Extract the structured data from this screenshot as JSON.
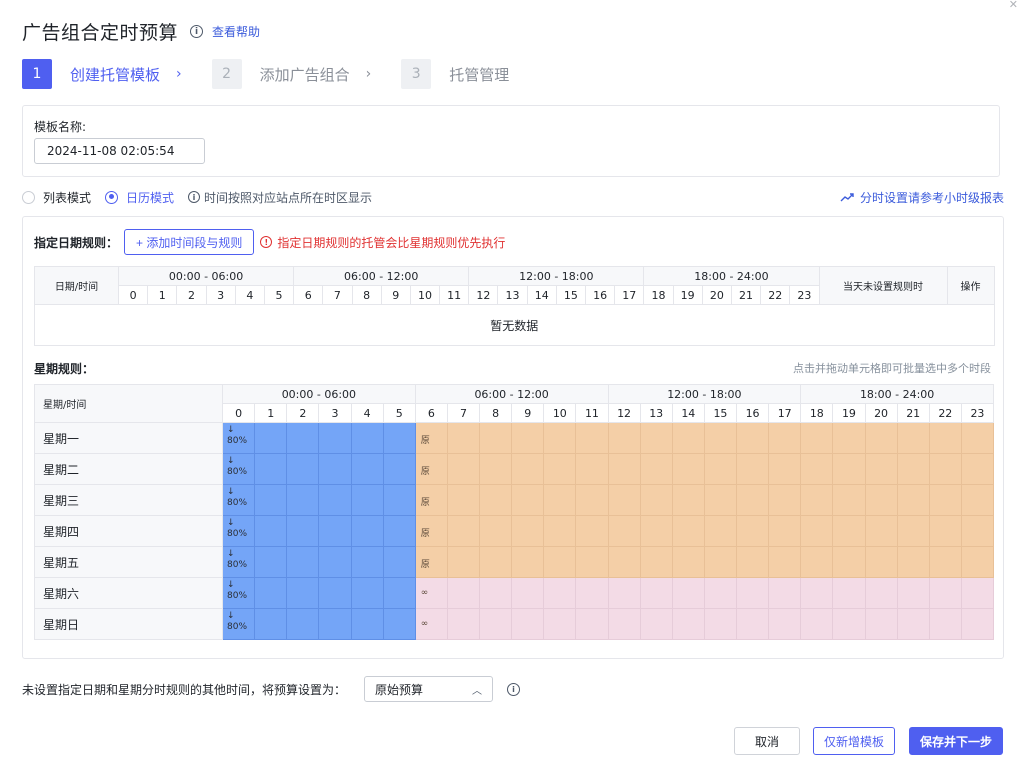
{
  "header": {
    "title": "广告组合定时预算",
    "help_link": "查看帮助"
  },
  "steps": [
    {
      "num": "1",
      "label": "创建托管模板",
      "arrow": "›"
    },
    {
      "num": "2",
      "label": "添加广告组合",
      "arrow": "›"
    },
    {
      "num": "3",
      "label": "托管管理"
    }
  ],
  "template": {
    "name_label": "模板名称:",
    "name_value": "2024-11-08 02:05:54"
  },
  "mode": {
    "list_label": "列表模式",
    "calendar_label": "日历模式",
    "selected": "calendar",
    "note": "时间按照对应站点所在时区显示",
    "report_link": "分时设置请参考小时级报表"
  },
  "date_rules": {
    "label": "指定日期规则：",
    "add_button": "+ 添加时间段与规则",
    "warning": "指定日期规则的托管会比星期规则优先执行",
    "col_date_time": "日期/时间",
    "ranges": [
      "00:00 - 06:00",
      "06:00 - 12:00",
      "12:00 - 18:00",
      "18:00 - 24:00"
    ],
    "hours": [
      "0",
      "1",
      "2",
      "3",
      "4",
      "5",
      "6",
      "7",
      "8",
      "9",
      "10",
      "11",
      "12",
      "13",
      "14",
      "15",
      "16",
      "17",
      "18",
      "19",
      "20",
      "21",
      "22",
      "23"
    ],
    "col_unset": "当天未设置规则时",
    "col_action": "操作",
    "empty_text": "暂无数据"
  },
  "week_rules": {
    "label": "星期规则：",
    "hint": "点击并拖动单元格即可批量选中多个时段",
    "col_week_time": "星期/时间",
    "ranges": [
      "00:00 - 06:00",
      "06:00 - 12:00",
      "12:00 - 18:00",
      "18:00 - 24:00"
    ],
    "hours": [
      "0",
      "1",
      "2",
      "3",
      "4",
      "5",
      "6",
      "7",
      "8",
      "9",
      "10",
      "11",
      "12",
      "13",
      "14",
      "15",
      "16",
      "17",
      "18",
      "19",
      "20",
      "21",
      "22",
      "23"
    ],
    "days": [
      {
        "name": "星期一",
        "zone6": "原",
        "fill": "peach"
      },
      {
        "name": "星期二",
        "zone6": "原",
        "fill": "peach"
      },
      {
        "name": "星期三",
        "zone6": "原",
        "fill": "peach"
      },
      {
        "name": "星期四",
        "zone6": "原",
        "fill": "peach"
      },
      {
        "name": "星期五",
        "zone6": "原",
        "fill": "peach"
      },
      {
        "name": "星期六",
        "zone6": "∞",
        "fill": "pink"
      },
      {
        "name": "星期日",
        "zone6": "∞",
        "fill": "pink"
      }
    ],
    "early_mark_arrow": "↓",
    "early_mark_pct": "80%"
  },
  "colors": {
    "accent": "#4f5ff0",
    "blue_cell": "#74a5f7",
    "peach_cell": "#f4cfa7",
    "pink_cell": "#f3dbe6",
    "warning": "#e03131"
  },
  "bottom": {
    "label": "未设置指定日期和星期分时规则的其他时间，将预算设置为：",
    "select_value": "原始预算"
  },
  "buttons": {
    "cancel": "取消",
    "save_template": "仅新增模板",
    "save_next": "保存并下一步"
  }
}
